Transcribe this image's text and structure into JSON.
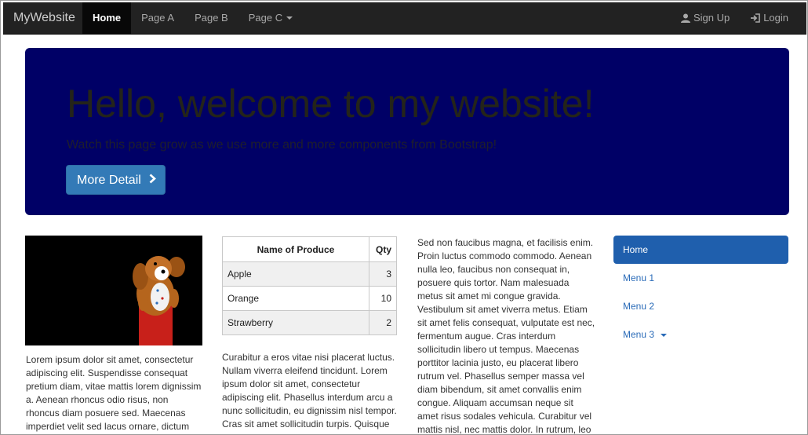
{
  "navbar": {
    "brand": "MyWebsite",
    "left_items": [
      {
        "label": "Home",
        "active": true
      },
      {
        "label": "Page A"
      },
      {
        "label": "Page B"
      },
      {
        "label": "Page C",
        "dropdown": true
      }
    ],
    "right_items": [
      {
        "label": "Sign Up",
        "icon": "user-icon"
      },
      {
        "label": "Login",
        "icon": "login-icon"
      }
    ]
  },
  "hero": {
    "title": "Hello, welcome to my website!",
    "subtitle": "Watch this page grow as we use more and more components from Bootstrap!",
    "button_label": "More Detail",
    "button_icon": "chevron-right-icon"
  },
  "column1": {
    "image": "toy-dog-figurine-photo",
    "text": "Lorem ipsum dolor sit amet, consectetur adipiscing elit. Suspendisse consequat pretium diam, vitae mattis lorem dignissim a. Aenean rhoncus odio risus, non rhoncus diam posuere sed. Maecenas imperdiet velit sed lacus ornare, dictum"
  },
  "produce_table": {
    "headers": [
      "Name of Produce",
      "Qty"
    ],
    "rows": [
      {
        "name": "Apple",
        "qty": "3"
      },
      {
        "name": "Orange",
        "qty": "10"
      },
      {
        "name": "Strawberry",
        "qty": "2"
      }
    ]
  },
  "column2": {
    "text": "Curabitur a eros vitae nisi placerat luctus. Nullam viverra eleifend tincidunt. Lorem ipsum dolor sit amet, consectetur adipiscing elit. Phasellus interdum arcu a nunc sollicitudin, eu dignissim nisl tempor. Cras sit amet sollicitudin turpis. Quisque"
  },
  "column3": {
    "text": "Sed non faucibus magna, et facilisis enim. Proin luctus commodo commodo. Aenean nulla leo, faucibus non consequat in, posuere quis tortor. Nam malesuada metus sit amet mi congue gravida. Vestibulum sit amet viverra metus. Etiam sit amet felis consequat, vulputate est nec, fermentum augue. Cras interdum sollicitudin libero ut tempus. Maecenas porttitor lacinia justo, eu placerat libero rutrum vel. Phasellus semper massa vel diam bibendum, sit amet convallis enim congue. Aliquam accumsan neque sit amet risus sodales vehicula. Curabitur vel mattis nisl, nec mattis dolor. In rutrum, leo"
  },
  "side_menu": {
    "items": [
      {
        "label": "Home",
        "active": true
      },
      {
        "label": "Menu 1"
      },
      {
        "label": "Menu 2"
      },
      {
        "label": "Menu 3",
        "dropdown": true
      }
    ]
  },
  "colors": {
    "navbar_bg": "#222222",
    "hero_bg": "#000066",
    "primary": "#337ab7",
    "link": "#2a6bb8"
  }
}
